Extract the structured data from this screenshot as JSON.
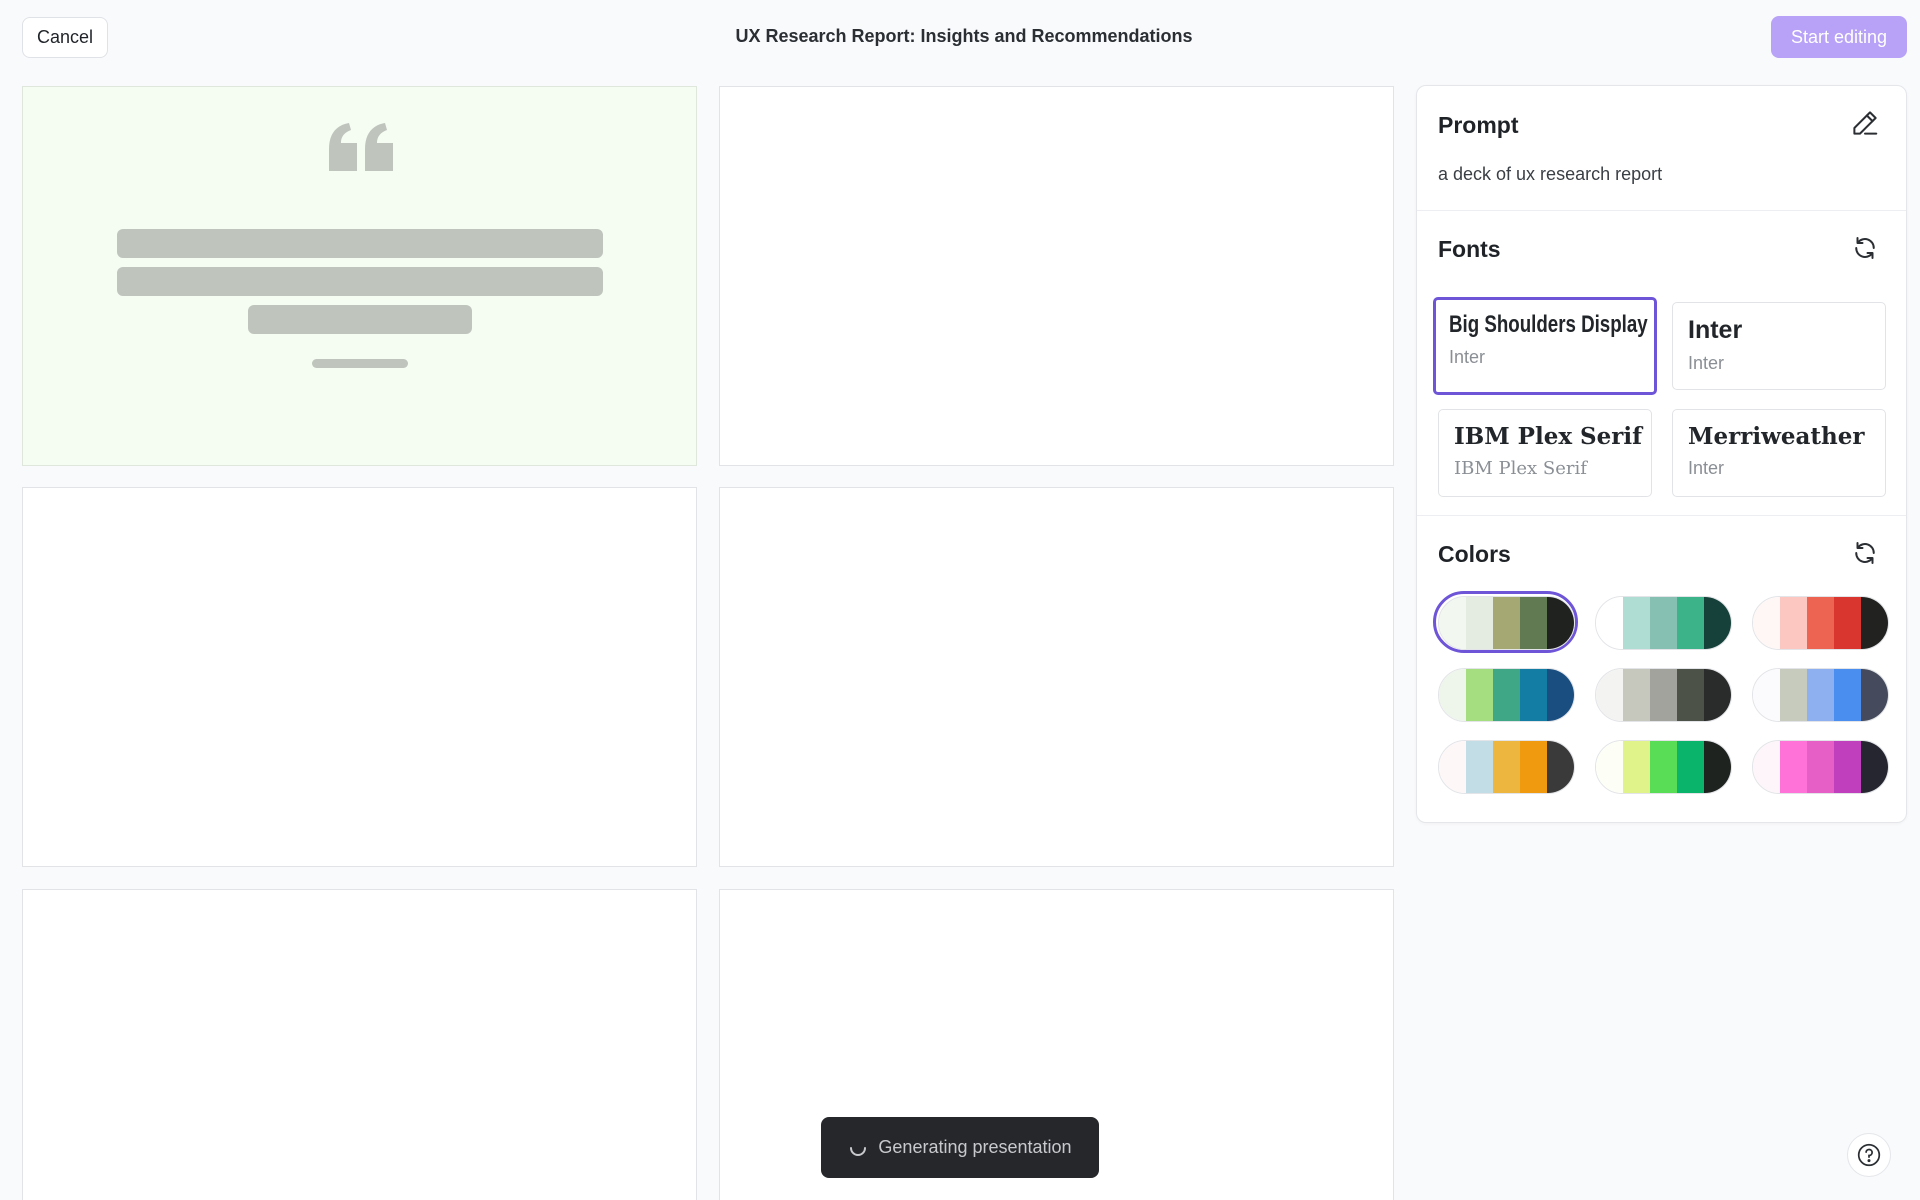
{
  "header": {
    "cancel_label": "Cancel",
    "title": "UX Research Report: Insights and Recommendations",
    "start_label": "Start editing"
  },
  "panel": {
    "prompt": {
      "title": "Prompt",
      "text": "a deck of ux research report",
      "icon": "pencil-icon"
    },
    "fonts": {
      "title": "Fonts",
      "icon": "refresh-icon",
      "items": [
        {
          "heading": "Big Shoulders Display",
          "body": "Inter",
          "selected": true
        },
        {
          "heading": "Inter",
          "body": "Inter",
          "selected": false
        },
        {
          "heading": "IBM Plex Serif",
          "body": "IBM Plex Serif",
          "selected": false
        },
        {
          "heading": "Merriweather",
          "body": "Inter",
          "selected": false
        }
      ]
    },
    "colors": {
      "title": "Colors",
      "icon": "refresh-icon",
      "selected_index": 0,
      "palettes": [
        [
          "#f2f7f0",
          "#e4ebe0",
          "#a6a874",
          "#617a51",
          "#202220"
        ],
        [
          "#ffffff",
          "#b0ddd3",
          "#85c0b2",
          "#3db38a",
          "#16403a"
        ],
        [
          "#fff7f6",
          "#fbc7c0",
          "#ee6453",
          "#d93630",
          "#222221"
        ],
        [
          "#eef6ec",
          "#a5de80",
          "#3fa786",
          "#137da4",
          "#1a4e80"
        ],
        [
          "#f3f4f2",
          "#c6c8bd",
          "#a3a39e",
          "#4d5249",
          "#2a2c2c"
        ],
        [
          "#fbfafc",
          "#c6cbbd",
          "#8fb0f0",
          "#4a8ef0",
          "#454b5c"
        ],
        [
          "#fdf7f8",
          "#c2dde6",
          "#edb63f",
          "#f09a10",
          "#3a3a3a"
        ],
        [
          "#fdfff7",
          "#dff38a",
          "#59dd57",
          "#0ab46a",
          "#1f2320"
        ],
        [
          "#fdf5f9",
          "#ff72d8",
          "#e65fc6",
          "#c03fbd",
          "#262630"
        ]
      ]
    }
  },
  "toast": {
    "text": "Generating presentation",
    "icon": "spinner-icon"
  },
  "help": {
    "icon": "help-icon"
  },
  "colors": {
    "accent": "#6e55d8",
    "start_button": "#b7a2f7",
    "placeholder": "#bfc5bd",
    "slide_tint": "#f5fcf2"
  }
}
